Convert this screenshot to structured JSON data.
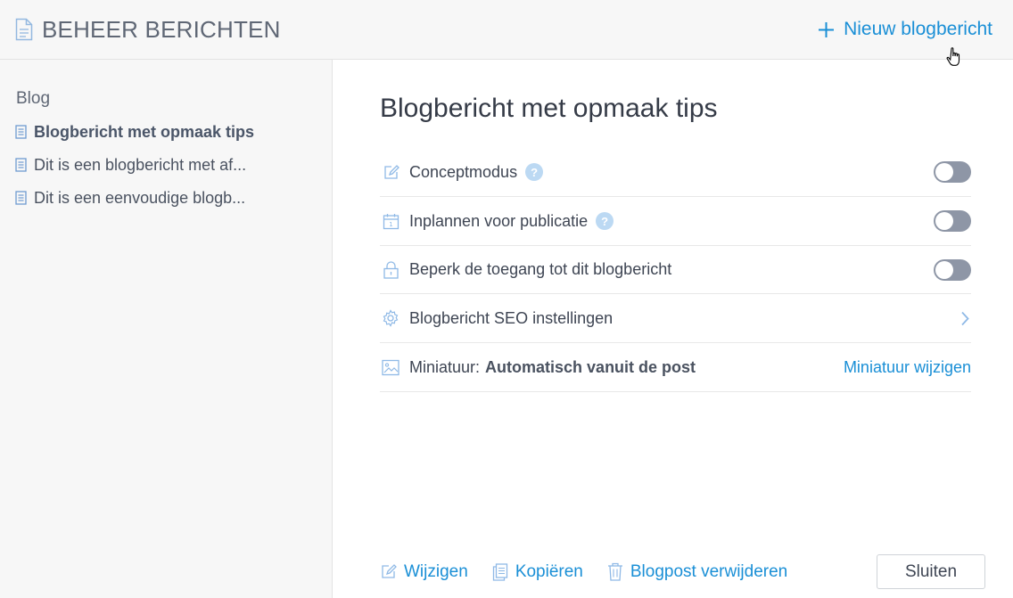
{
  "header": {
    "title": "BEHEER BERICHTEN",
    "new_post_label": "Nieuw blogbericht"
  },
  "sidebar": {
    "heading": "Blog",
    "items": [
      {
        "label": "Blogbericht met opmaak tips",
        "active": true
      },
      {
        "label": "Dit is een blogbericht met af...",
        "active": false
      },
      {
        "label": "Dit is een eenvoudige blogb...",
        "active": false
      }
    ]
  },
  "main": {
    "title": "Blogbericht met opmaak tips",
    "settings": {
      "concept": {
        "label": "Conceptmodus",
        "help": "?",
        "on": false
      },
      "schedule": {
        "label": "Inplannen voor publicatie",
        "help": "?",
        "on": false
      },
      "restrict": {
        "label": "Beperk de toegang tot dit blogbericht",
        "on": false
      },
      "seo": {
        "label": "Blogbericht SEO instellingen"
      },
      "thumbnail": {
        "label": "Miniatuur:",
        "value": "Automatisch vanuit de post",
        "action": "Miniatuur wijzigen"
      }
    }
  },
  "footer": {
    "edit": "Wijzigen",
    "copy": "Kopiëren",
    "delete": "Blogpost verwijderen",
    "close": "Sluiten"
  },
  "colors": {
    "accent": "#1a8fd6",
    "toggle_off": "#8e96a6",
    "sidebar_bg": "#f7f7f7",
    "icon": "#8fb9e6"
  }
}
